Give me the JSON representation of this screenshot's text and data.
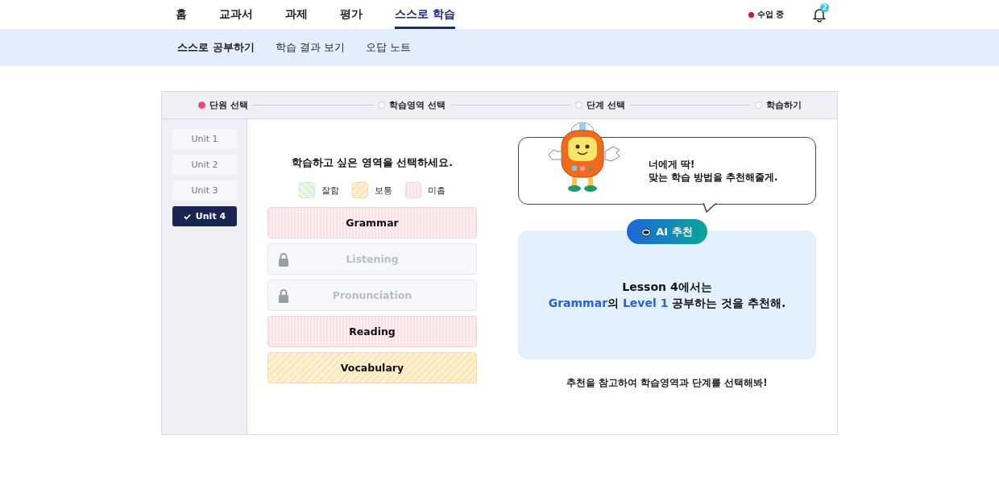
{
  "nav": {
    "tabs": [
      {
        "label": "홈",
        "selected": false
      },
      {
        "label": "교과서",
        "selected": false
      },
      {
        "label": "과제",
        "selected": false
      },
      {
        "label": "평가",
        "selected": false
      },
      {
        "label": "스스로 학습",
        "selected": true
      }
    ],
    "status": {
      "label": "수업 중",
      "live": true
    },
    "notifications": {
      "count": "2"
    }
  },
  "subnav": [
    {
      "label": "스스로 공부하기",
      "selected": true
    },
    {
      "label": "학습 결과 보기",
      "selected": false
    },
    {
      "label": "오답 노트",
      "selected": false
    }
  ],
  "steps": [
    {
      "label": "단원 선택",
      "selected": true
    },
    {
      "label": "학습영역 선택",
      "selected": false
    },
    {
      "label": "단계 선택",
      "selected": false
    },
    {
      "label": "학습하기",
      "selected": false
    }
  ],
  "units": [
    {
      "label": "Unit 1",
      "selected": false
    },
    {
      "label": "Unit 2",
      "selected": false
    },
    {
      "label": "Unit 3",
      "selected": false
    },
    {
      "label": "Unit 4",
      "selected": true
    }
  ],
  "prompt": "학습하고 싶은 영역을 선택하세요.",
  "legend": [
    {
      "label": "잘함",
      "kind": "good"
    },
    {
      "label": "보통",
      "kind": "fair"
    },
    {
      "label": "미흡",
      "kind": "weak"
    }
  ],
  "areas": [
    {
      "label": "Grammar",
      "kind": "weak"
    },
    {
      "label": "Listening",
      "kind": "locked"
    },
    {
      "label": "Pronunciation",
      "kind": "locked"
    },
    {
      "label": "Reading",
      "kind": "weak"
    },
    {
      "label": "Vocabulary",
      "kind": "fair"
    }
  ],
  "speech": [
    "너에게 딱!",
    "맞는 학습 방법을 추천해줄게."
  ],
  "recommendation": {
    "badge": "AI 추천",
    "lines": [
      [
        {
          "text": "Lesson 4에서는",
          "highlight": false
        }
      ],
      [
        {
          "text": "Grammar",
          "highlight": true
        },
        {
          "text": "의 ",
          "highlight": false
        },
        {
          "text": "Level 1",
          "highlight": true
        },
        {
          "text": " 공부하는 것을 추천해.",
          "highlight": false
        }
      ]
    ]
  },
  "hint": "추천을 참고하여 학습영역과 단계를 선택해봐!"
}
